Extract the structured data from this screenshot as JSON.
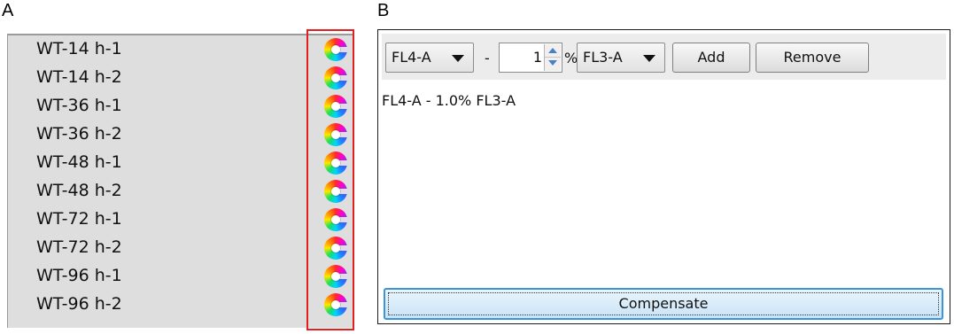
{
  "panels": {
    "a_label": "A",
    "b_label": "B"
  },
  "panel_a": {
    "samples": [
      {
        "label": "WT-14 h-1",
        "icon": "color-wheel-icon"
      },
      {
        "label": "WT-14 h-2",
        "icon": "color-wheel-icon"
      },
      {
        "label": "WT-36 h-1",
        "icon": "color-wheel-icon"
      },
      {
        "label": "WT-36 h-2",
        "icon": "color-wheel-icon"
      },
      {
        "label": "WT-48 h-1",
        "icon": "color-wheel-icon"
      },
      {
        "label": "WT-48 h-2",
        "icon": "color-wheel-icon"
      },
      {
        "label": "WT-72 h-1",
        "icon": "color-wheel-icon"
      },
      {
        "label": "WT-72 h-2",
        "icon": "color-wheel-icon"
      },
      {
        "label": "WT-96 h-1",
        "icon": "color-wheel-icon"
      },
      {
        "label": "WT-96 h-2",
        "icon": "color-wheel-icon"
      }
    ],
    "highlight_color": "#e32020"
  },
  "panel_b": {
    "toolbar": {
      "source_channel": "FL4-A",
      "minus_sign": "-",
      "percent_value": "1",
      "percent_sign": "%",
      "target_channel": "FL3-A",
      "add_label": "Add",
      "remove_label": "Remove"
    },
    "entries": [
      "FL4-A - 1.0% FL3-A"
    ],
    "compensate_label": "Compensate",
    "accent_color": "#3a96d6"
  }
}
